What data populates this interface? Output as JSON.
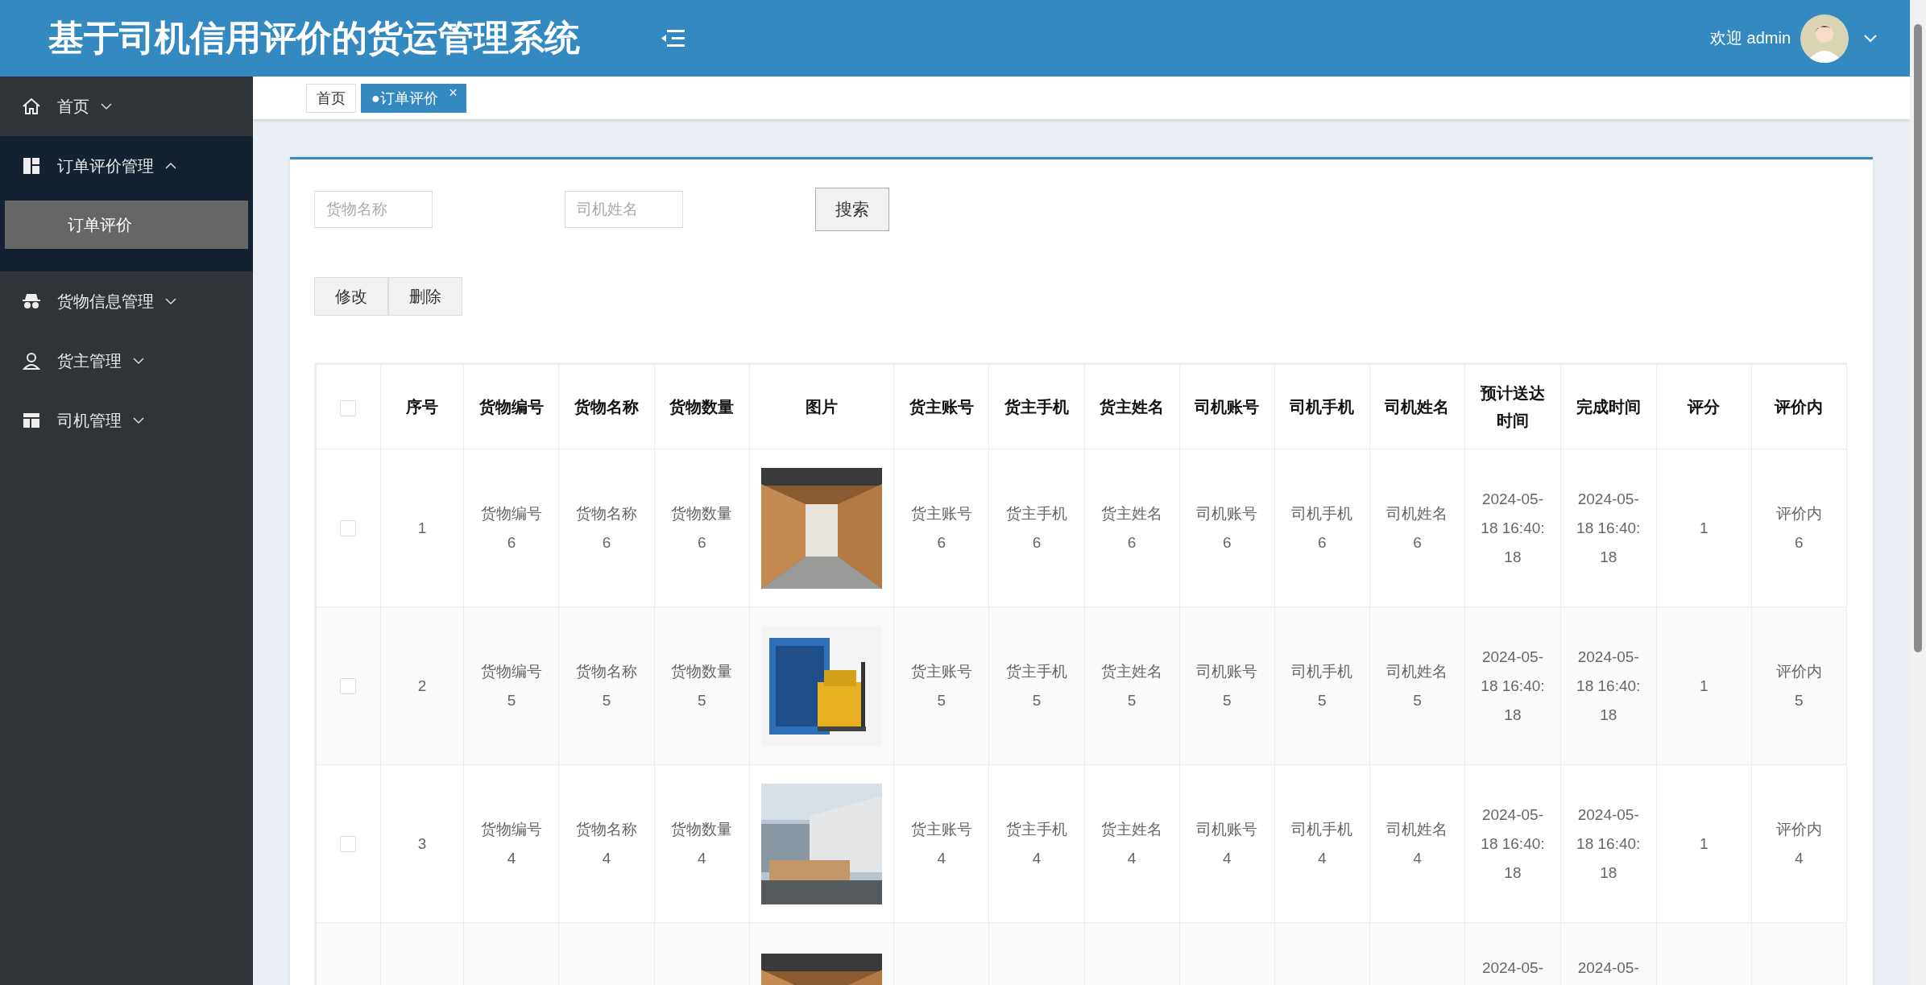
{
  "header": {
    "title": "基于司机信用评价的货运管理系统",
    "welcome": "欢迎 admin"
  },
  "sidebar": {
    "items": [
      {
        "label": "首页",
        "expanded": false
      },
      {
        "label": "订单评价管理",
        "expanded": true,
        "children": [
          {
            "label": "订单评价",
            "selected": true
          }
        ]
      },
      {
        "label": "货物信息管理",
        "expanded": false
      },
      {
        "label": "货主管理",
        "expanded": false
      },
      {
        "label": "司机管理",
        "expanded": false
      }
    ]
  },
  "tabs": [
    {
      "label": "首页",
      "selected": false
    },
    {
      "label": "●订单评价",
      "selected": true,
      "close": "×"
    }
  ],
  "search": {
    "fields": [
      {
        "placeholder": "货物名称"
      },
      {
        "placeholder": "司机姓名"
      }
    ],
    "button": "搜索"
  },
  "actions": [
    "修改",
    "删除"
  ],
  "table": {
    "header_checked": false,
    "columns": [
      {
        "kind": "checkbox"
      },
      {
        "kind": "text",
        "label": "序号"
      },
      {
        "kind": "text",
        "label": "货物编号"
      },
      {
        "kind": "text",
        "label": "货物名称"
      },
      {
        "kind": "text",
        "label": "货物数量"
      },
      {
        "kind": "picture",
        "label": "图片"
      },
      {
        "kind": "text",
        "label": "货主账号"
      },
      {
        "kind": "text",
        "label": "货主手机"
      },
      {
        "kind": "text",
        "label": "货主姓名"
      },
      {
        "kind": "text",
        "label": "司机账号"
      },
      {
        "kind": "text",
        "label": "司机手机"
      },
      {
        "kind": "text",
        "label": "司机姓名"
      },
      {
        "kind": "text",
        "label": "预计送达时间"
      },
      {
        "kind": "text",
        "label": "完成时间"
      },
      {
        "kind": "text",
        "label": "评分"
      },
      {
        "kind": "text",
        "label": "评价内"
      }
    ],
    "rows": [
      {
        "checked": false,
        "cells": [
          "",
          "1",
          "货物编号\n6",
          "货物名称\n6",
          "货物数量\n6",
          "",
          "货主账号\n6",
          "货主手机\n6",
          "货主姓名\n6",
          "司机账号\n6",
          "司机手机\n6",
          "司机姓名\n6",
          "2024-05-\n18 16:40:\n18",
          "2024-05-\n18 16:40:\n18",
          "1",
          "评价内\n6"
        ]
      },
      {
        "checked": false,
        "cells": [
          "",
          "2",
          "货物编号\n5",
          "货物名称\n5",
          "货物数量\n5",
          "",
          "货主账号\n5",
          "货主手机\n5",
          "货主姓名\n5",
          "司机账号\n5",
          "司机手机\n5",
          "司机姓名\n5",
          "2024-05-\n18 16:40:\n18",
          "2024-05-\n18 16:40:\n18",
          "1",
          "评价内\n5"
        ]
      },
      {
        "checked": false,
        "cells": [
          "",
          "3",
          "货物编号\n4",
          "货物名称\n4",
          "货物数量\n4",
          "",
          "货主账号\n4",
          "货主手机\n4",
          "货主姓名\n4",
          "司机账号\n4",
          "司机手机\n4",
          "司机姓名\n4",
          "2024-05-\n18 16:40:\n18",
          "2024-05-\n18 16:40:\n18",
          "1",
          "评价内\n4"
        ]
      },
      {
        "cells": [
          "",
          "",
          "",
          "",
          "",
          "",
          "",
          "",
          "",
          "",
          "",
          "",
          "2024-05-",
          "2024-05-"
        ]
      }
    ]
  }
}
